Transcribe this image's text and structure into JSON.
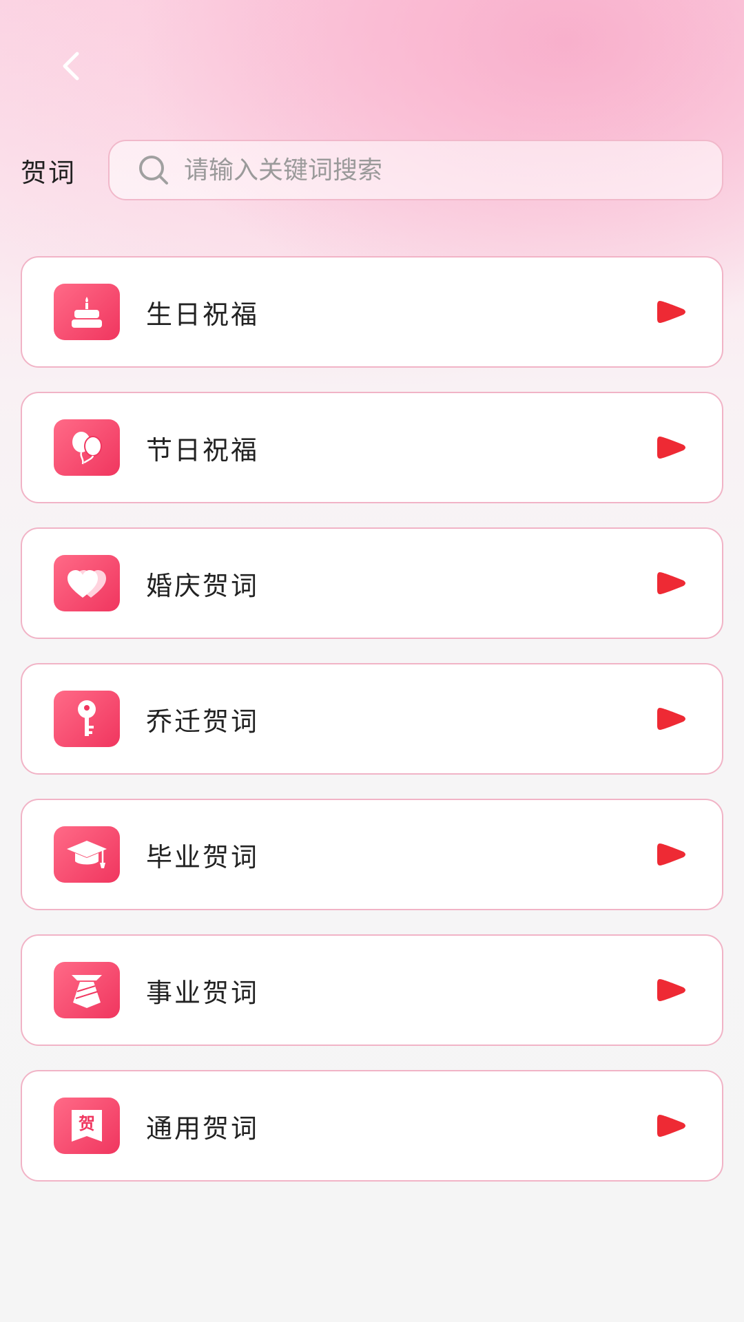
{
  "header": {
    "back_icon": "chevron-left-icon"
  },
  "search": {
    "label": "贺词",
    "placeholder": "请输入关键词搜索",
    "value": "",
    "icon": "search-icon"
  },
  "categories": [
    {
      "label": "生日祝福",
      "icon": "birthday-cake-icon"
    },
    {
      "label": "节日祝福",
      "icon": "balloons-icon"
    },
    {
      "label": "婚庆贺词",
      "icon": "double-heart-icon"
    },
    {
      "label": "乔迁贺词",
      "icon": "key-icon"
    },
    {
      "label": "毕业贺词",
      "icon": "graduation-cap-icon"
    },
    {
      "label": "事业贺词",
      "icon": "necktie-icon"
    },
    {
      "label": "通用贺词",
      "icon": "he-character-icon",
      "icon_text": "贺"
    }
  ],
  "colors": {
    "accent": "#f0365f",
    "play": "#ee2a34",
    "card_border": "#f1b3c6"
  }
}
